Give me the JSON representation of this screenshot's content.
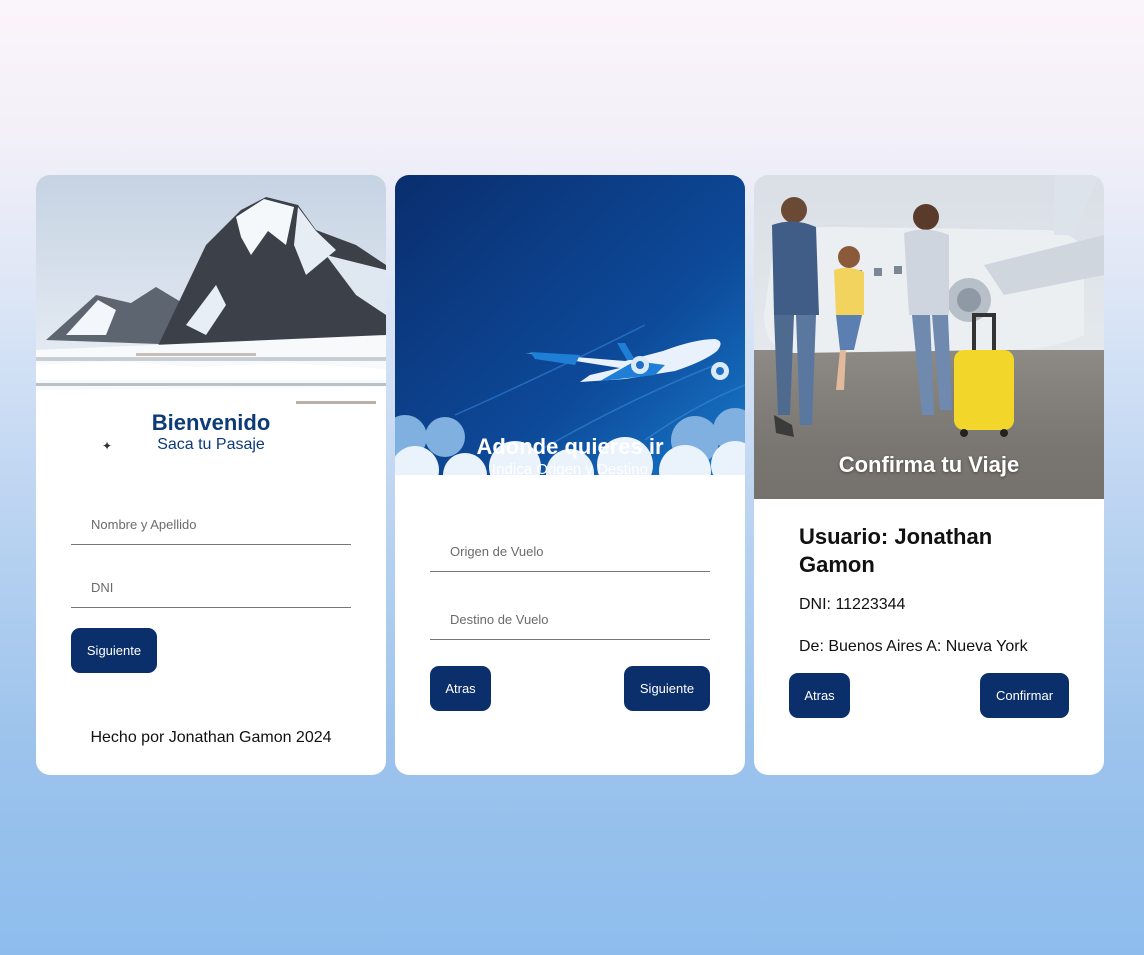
{
  "welcome_card": {
    "title": "Bienvenido",
    "subtitle": "Saca tu Pasaje",
    "name_placeholder": "Nombre y Apellido",
    "dni_placeholder": "DNI",
    "next_label": "Siguiente",
    "footer": "Hecho por Jonathan Gamon 2024"
  },
  "route_card": {
    "title": "Adonde quieres ir",
    "subtitle": "Indica Origen y Destino",
    "origin_placeholder": "Origen de Vuelo",
    "destination_placeholder": "Destino de Vuelo",
    "back_label": "Atras",
    "next_label": "Siguiente"
  },
  "confirm_card": {
    "title": "Confirma tu Viaje",
    "user_line": "Usuario: Jonathan Gamon",
    "dni_line": "DNI: 11223344",
    "route_line": "De: Buenos Aires A: Nueva York",
    "back_label": "Atras",
    "confirm_label": "Confirmar"
  },
  "colors": {
    "button": "#0b2f6b",
    "heading_blue": "#0c3b78"
  }
}
